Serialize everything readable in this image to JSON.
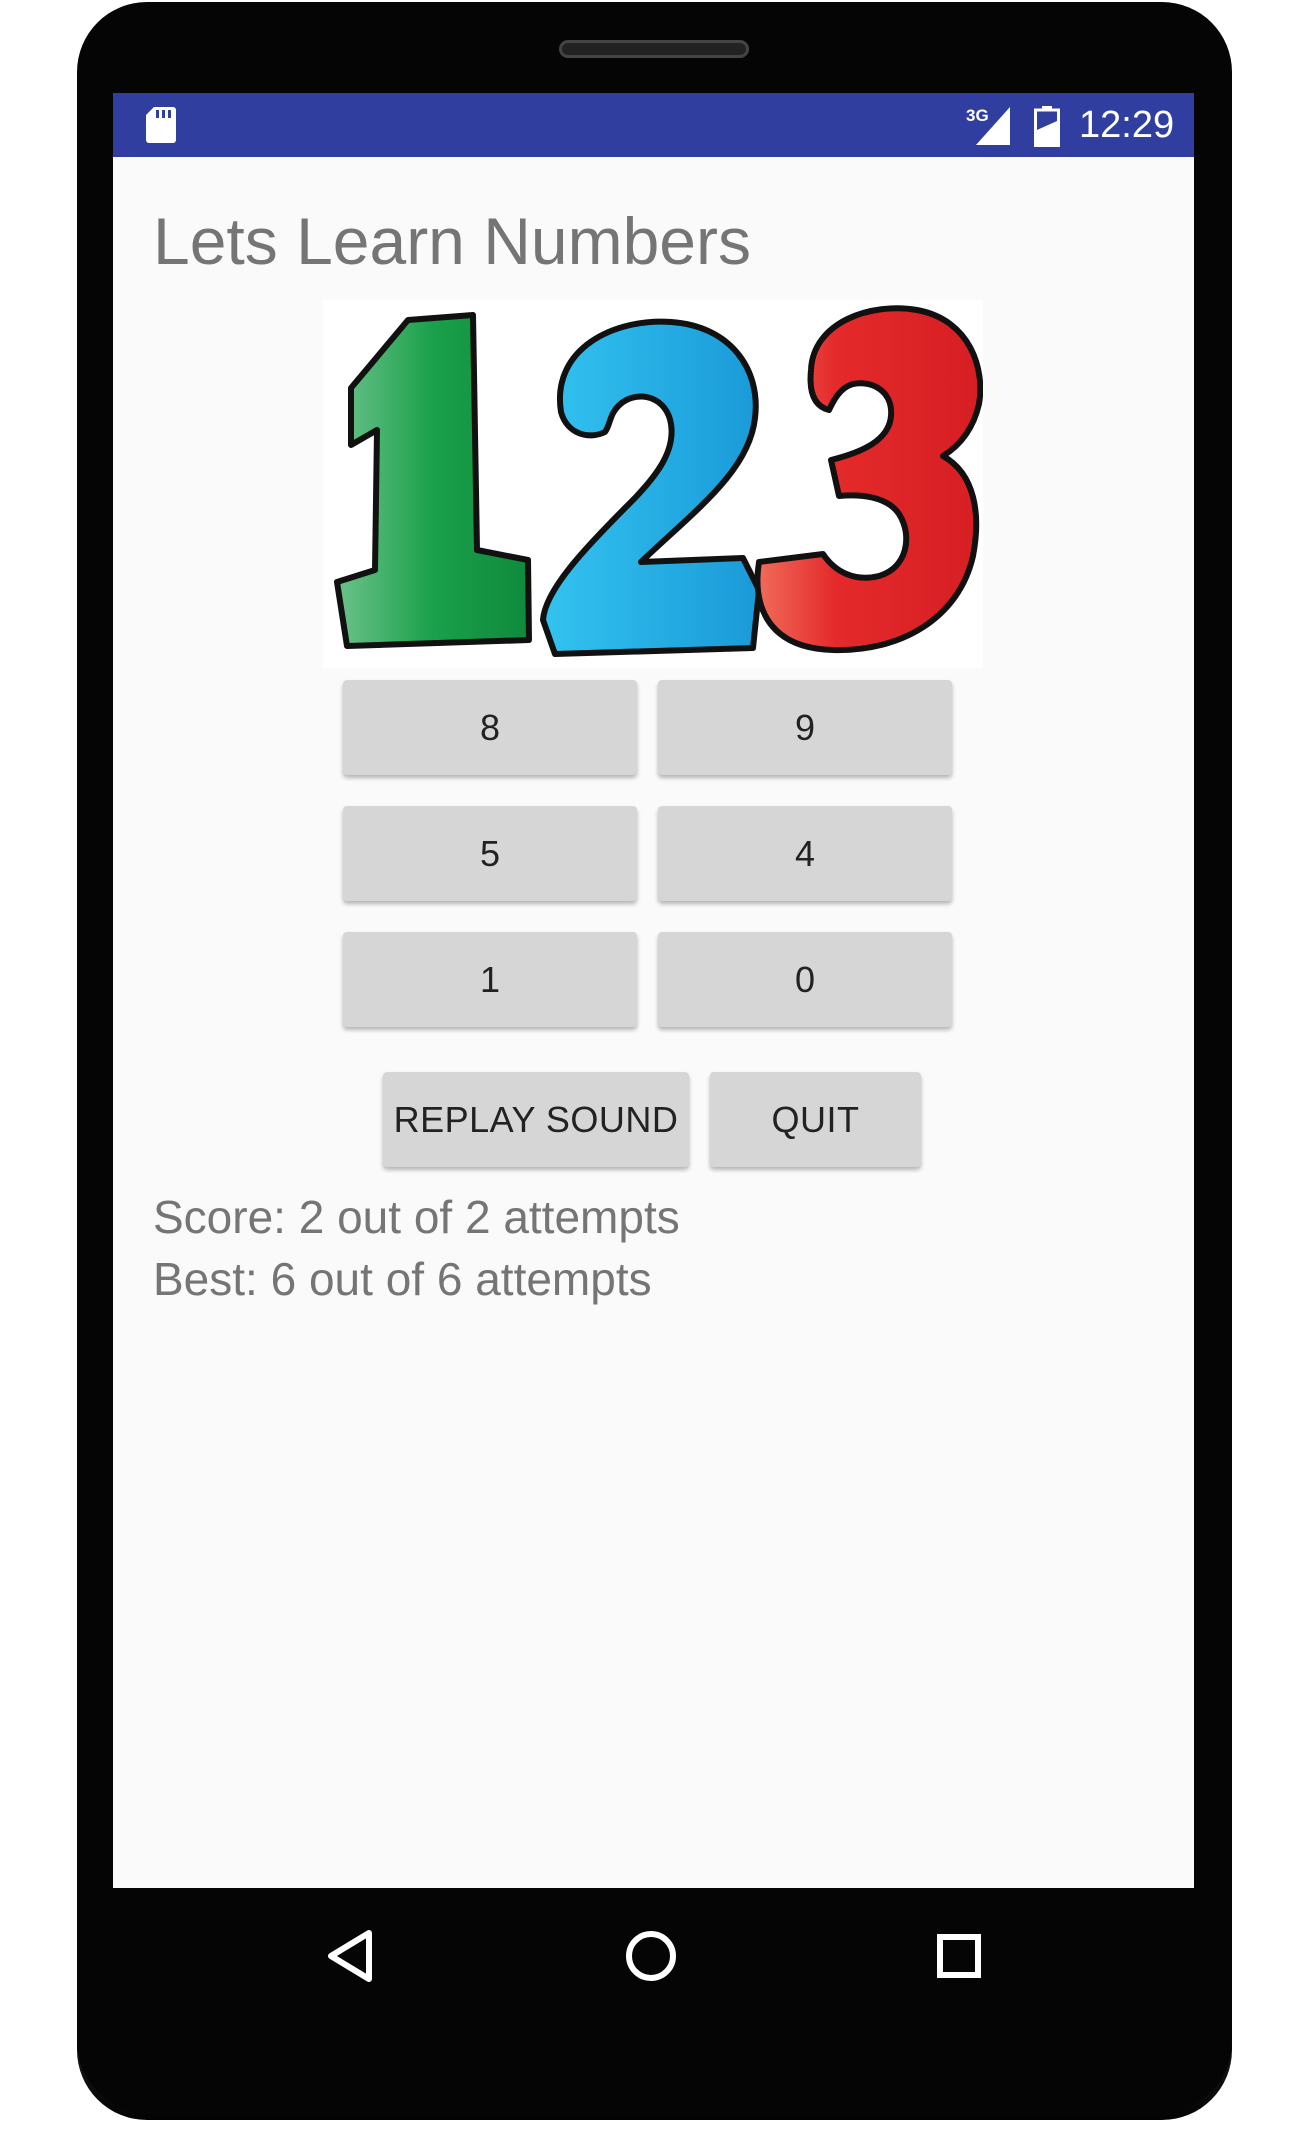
{
  "status_bar": {
    "network_label": "3G",
    "time": "12:29",
    "icons": [
      "sd-card-icon",
      "signal-3g-icon",
      "battery-icon"
    ]
  },
  "app": {
    "title": "Lets Learn Numbers",
    "logo": {
      "digits": [
        "1",
        "2",
        "3"
      ],
      "colors": [
        "#1aa04a",
        "#2cb5e8",
        "#e21d2a"
      ]
    },
    "number_buttons": [
      {
        "label": "8"
      },
      {
        "label": "9"
      },
      {
        "label": "5"
      },
      {
        "label": "4"
      },
      {
        "label": "1"
      },
      {
        "label": "0"
      }
    ],
    "replay_label": "REPLAY SOUND",
    "quit_label": "QUIT",
    "score_text": "Score: 2 out of 2 attempts",
    "best_text": "Best: 6 out of 6 attempts"
  },
  "nav_bar": {
    "icons": [
      "back-icon",
      "home-icon",
      "recents-icon"
    ]
  },
  "colors": {
    "status_bar": "#303f9f",
    "background": "#fafafa",
    "button": "#d6d6d6",
    "text_gray": "#757575"
  }
}
